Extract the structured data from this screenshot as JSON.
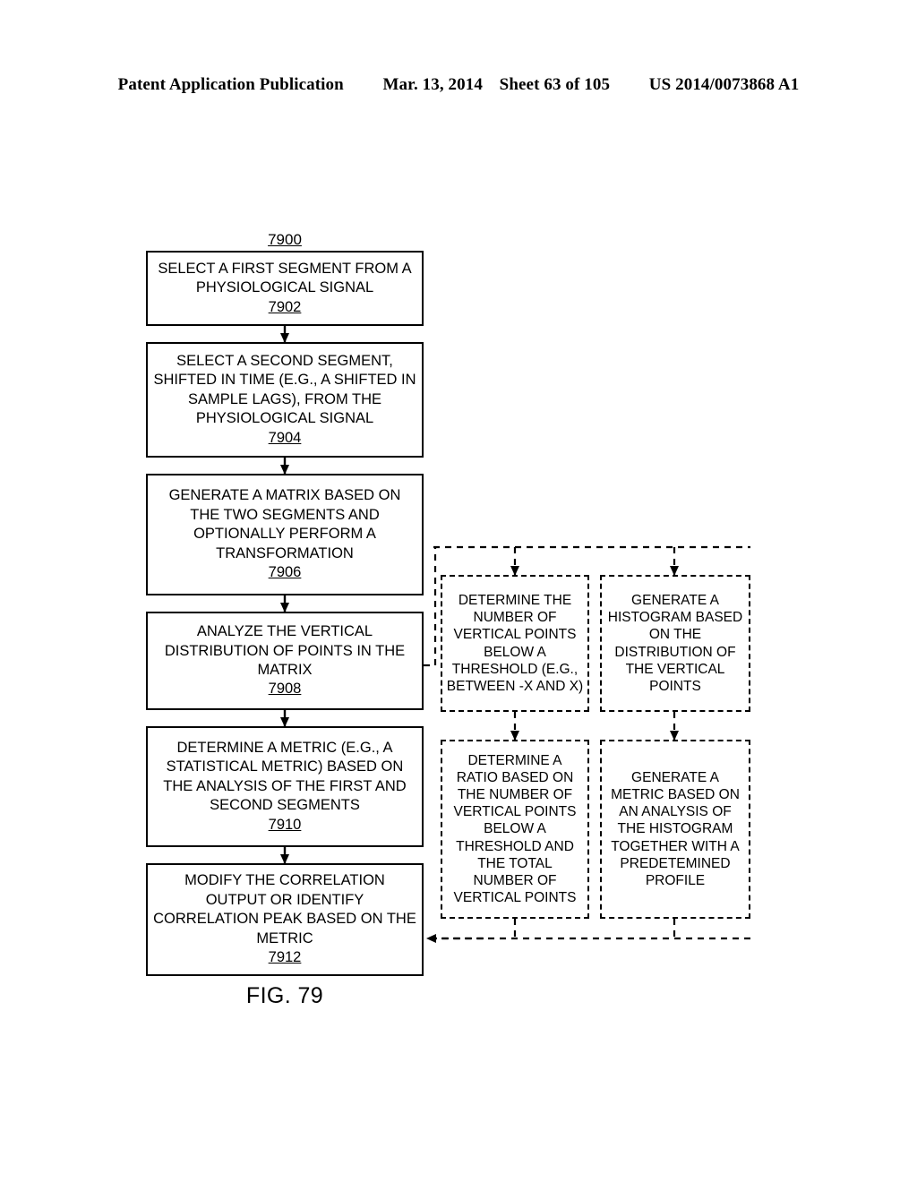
{
  "header": {
    "publication": "Patent Application Publication",
    "date": "Mar. 13, 2014",
    "sheet": "Sheet 63 of 105",
    "number": "US 2014/0073868 A1"
  },
  "figure": {
    "caption": "FIG. 79",
    "diagram_label": "7900"
  },
  "flow": {
    "main_steps": [
      {
        "id": "7902",
        "text": "SELECT A FIRST SEGMENT FROM A PHYSIOLOGICAL SIGNAL",
        "ref": "7902"
      },
      {
        "id": "7904",
        "text": "SELECT A SECOND SEGMENT, SHIFTED IN TIME (E.G., A SHIFTED IN SAMPLE LAGS), FROM THE PHYSIOLOGICAL SIGNAL",
        "ref": "7904"
      },
      {
        "id": "7906",
        "text": "GENERATE A MATRIX BASED ON THE TWO SEGMENTS AND OPTIONALLY PERFORM A TRANSFORMATION",
        "ref": "7906"
      },
      {
        "id": "7908",
        "text": "ANALYZE THE VERTICAL DISTRIBUTION OF POINTS IN THE MATRIX",
        "ref": "7908"
      },
      {
        "id": "7910",
        "text": "DETERMINE A METRIC (E.G., A STATISTICAL METRIC) BASED ON THE ANALYSIS OF THE FIRST AND SECOND SEGMENTS",
        "ref": "7910"
      },
      {
        "id": "7912",
        "text": "MODIFY THE CORRELATION OUTPUT OR IDENTIFY CORRELATION PEAK BASED ON THE METRIC",
        "ref": "7912"
      }
    ],
    "optional_steps": [
      {
        "id": "determine-number",
        "text": "DETERMINE THE NUMBER OF VERTICAL POINTS BELOW A THRESHOLD (E.G., BETWEEN -X AND X)"
      },
      {
        "id": "generate-histogram",
        "text": "GENERATE A HISTOGRAM BASED ON THE DISTRIBUTION OF THE VERTICAL POINTS"
      },
      {
        "id": "determine-ratio",
        "text": "DETERMINE A RATIO BASED ON THE NUMBER OF VERTICAL POINTS BELOW A THRESHOLD AND THE TOTAL NUMBER OF VERTICAL POINTS"
      },
      {
        "id": "generate-metric",
        "text": "GENERATE A METRIC BASED ON AN ANALYSIS OF THE HISTOGRAM TOGETHER WITH A PREDETEMINED PROFILE"
      }
    ]
  }
}
